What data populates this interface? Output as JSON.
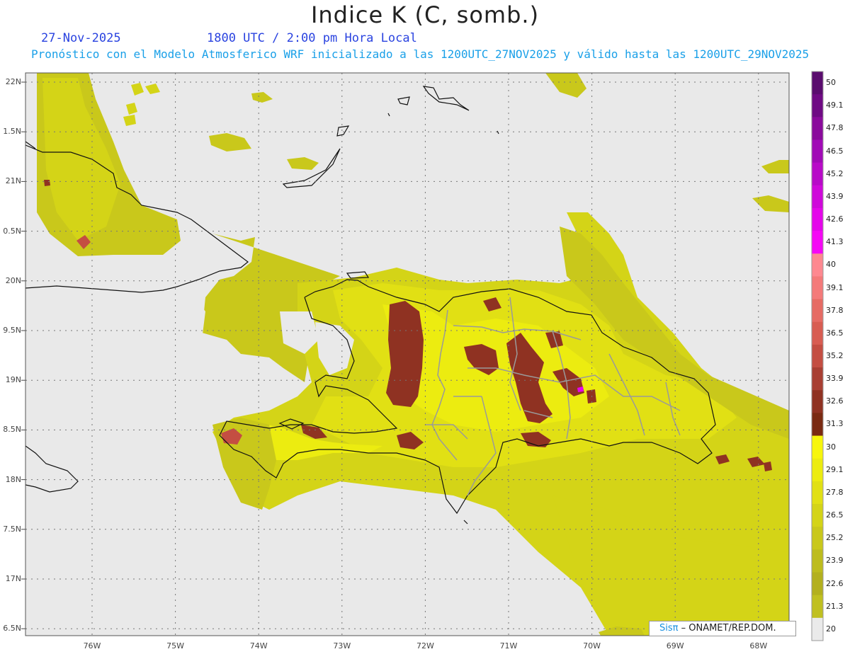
{
  "header": {
    "title": "Indice K (C, somb.)",
    "date": "27-Nov-2025",
    "time": "1800 UTC / 2:00 pm Hora Local",
    "forecast_text": "Pronóstico con el Modelo Atmosferico WRF inicializado a las 1200UTC_27NOV2025 y válido hasta las  1200UTC_29NOV2025"
  },
  "map": {
    "lat_labels": [
      "22N",
      "1.5N",
      "21N",
      "0.5N",
      "20N",
      "9.5N",
      "19N",
      "8.5N",
      "18N",
      "7.5N",
      "17N",
      "6.5N"
    ],
    "lon_labels": [
      "76W",
      "75W",
      "74W",
      "73W",
      "72W",
      "71W",
      "70W",
      "69W",
      "68W"
    ],
    "background_color": "#e9e9e9",
    "coast_color": "#111111",
    "province_border_color": "#9a9a9a"
  },
  "colorbar": {
    "levels": [
      "50",
      "49.1",
      "47.8",
      "46.5",
      "45.2",
      "43.9",
      "42.6",
      "41.3",
      "40",
      "39.1",
      "37.8",
      "36.5",
      "35.2",
      "33.9",
      "32.6",
      "31.3",
      "30",
      "29.1",
      "27.8",
      "26.5",
      "25.2",
      "23.9",
      "22.6",
      "21.3",
      "20"
    ],
    "colors": [
      "#5a0c6e",
      "#6f0a84",
      "#8a0a9c",
      "#a10ab6",
      "#b80ac8",
      "#cf08da",
      "#e406ea",
      "#f508f5",
      "#fe8890",
      "#f47a7a",
      "#e66b64",
      "#d85d52",
      "#c44e42",
      "#a93f33",
      "#8f3222",
      "#7a2a12",
      "#f7f60c",
      "#ecec10",
      "#e1e014",
      "#d4d417",
      "#c9c81b",
      "#bdbc1d",
      "#b3b01e",
      "#c0c020",
      "#eaeaea"
    ]
  },
  "credit": {
    "sis": "Sisπ",
    "org": " – ONAMET/REP.DOM."
  }
}
